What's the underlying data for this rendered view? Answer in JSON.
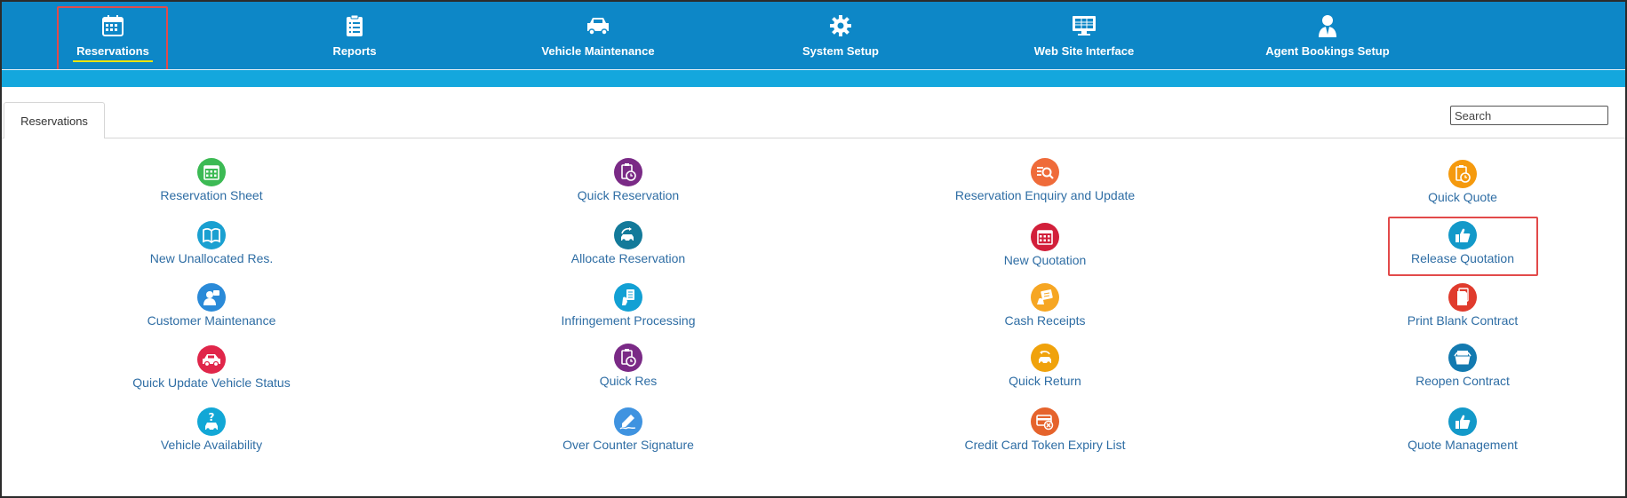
{
  "nav": {
    "items": [
      {
        "label": "Reservations",
        "icon": "calendar-icon"
      },
      {
        "label": "Reports",
        "icon": "checklist-icon"
      },
      {
        "label": "Vehicle Maintenance",
        "icon": "car-icon"
      },
      {
        "label": "System Setup",
        "icon": "gear-icon"
      },
      {
        "label": "Web Site Interface",
        "icon": "monitor-icon"
      },
      {
        "label": "Agent Bookings Setup",
        "icon": "agent-icon"
      }
    ],
    "active": "Reservations"
  },
  "tab": {
    "label": "Reservations"
  },
  "search": {
    "placeholder": "Search"
  },
  "menu": {
    "col1": [
      {
        "label": "Reservation Sheet",
        "icon": "calendar-icon",
        "color": "#3cba54"
      },
      {
        "label": "New Unallocated Res.",
        "icon": "book-icon",
        "color": "#1aa0d1"
      },
      {
        "label": "Customer Maintenance",
        "icon": "user-icon",
        "color": "#2a8ad8"
      },
      {
        "label": "Quick Update Vehicle Status",
        "icon": "car-icon",
        "color": "#e0264a"
      },
      {
        "label": "Vehicle Availability",
        "icon": "car-question-icon",
        "color": "#12a7d6"
      }
    ],
    "col2": [
      {
        "label": "Quick Reservation",
        "icon": "clipboard-clock-icon",
        "color": "#7a2a86"
      },
      {
        "label": "Allocate Reservation",
        "icon": "car-swap-icon",
        "color": "#137a9a"
      },
      {
        "label": "Infringement Processing",
        "icon": "document-hand-icon",
        "color": "#12a0d4"
      },
      {
        "label": "Quick Res",
        "icon": "clipboard-clock-icon",
        "color": "#7a2a86"
      },
      {
        "label": "Over Counter Signature",
        "icon": "pen-icon",
        "color": "#3f93e0"
      }
    ],
    "col3": [
      {
        "label": "Reservation Enquiry and Update",
        "icon": "search-list-icon",
        "color": "#ef6b3a"
      },
      {
        "label": "New Quotation",
        "icon": "calendar-icon",
        "color": "#d21f3a"
      },
      {
        "label": "Cash Receipts",
        "icon": "receipt-icon",
        "color": "#f6a623"
      },
      {
        "label": "Quick Return",
        "icon": "car-return-icon",
        "color": "#f0a20b"
      },
      {
        "label": "Credit Card Token Expiry List",
        "icon": "credit-card-icon",
        "color": "#e5632c"
      }
    ],
    "col4": [
      {
        "label": "Quick Quote",
        "icon": "clipboard-clock-icon",
        "color": "#f59a0e"
      },
      {
        "label": "Release Quotation",
        "icon": "thumbs-up-icon",
        "color": "#1399c9"
      },
      {
        "label": "Print Blank Contract",
        "icon": "document-icon",
        "color": "#e03b2d"
      },
      {
        "label": "Reopen Contract",
        "icon": "open-folder-icon",
        "color": "#137ab0"
      },
      {
        "label": "Quote Management",
        "icon": "thumbs-up-icon",
        "color": "#1399c9"
      }
    ]
  }
}
